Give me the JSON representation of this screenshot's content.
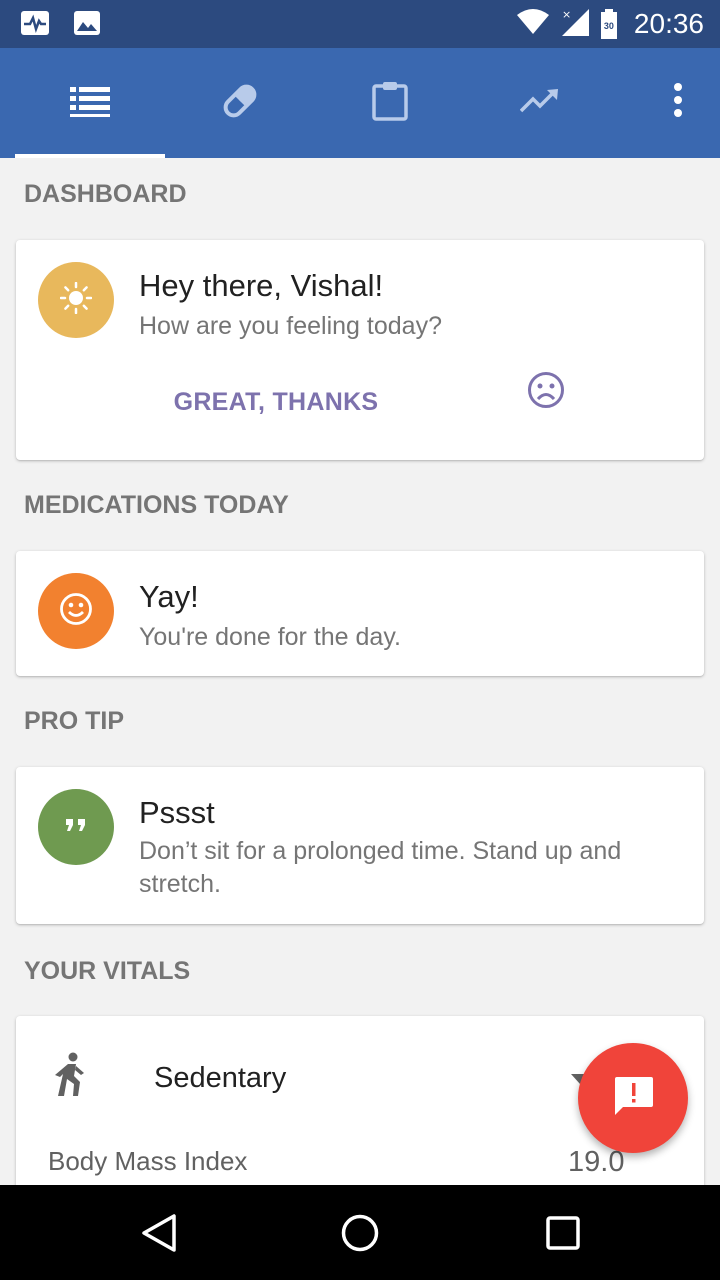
{
  "status_bar": {
    "time": "20:36",
    "left_icons": [
      "pulse-notification-icon",
      "image-notification-icon"
    ],
    "right_icons": [
      "wifi-icon",
      "signal-icon",
      "battery-icon"
    ],
    "battery_level": "30"
  },
  "app_bar": {
    "tabs": [
      {
        "name": "dashboard",
        "icon": "list-icon",
        "active": true
      },
      {
        "name": "medications",
        "icon": "pill-icon",
        "active": false
      },
      {
        "name": "records",
        "icon": "clipboard-icon",
        "active": false
      },
      {
        "name": "trends",
        "icon": "trending-icon",
        "active": false
      }
    ],
    "overflow_icon": "more-vert-icon"
  },
  "dashboard": {
    "title": "DASHBOARD",
    "greeting": "Hey there, Vishal!",
    "question": "How are you feeling today?",
    "great_button": "GREAT, THANKS",
    "sad_icon": "sad-face-icon",
    "avatar_icon": "sun-icon",
    "avatar_color": "#e8b85c"
  },
  "medications": {
    "title": "MEDICATIONS TODAY",
    "heading": "Yay!",
    "message": "You're done for the day.",
    "avatar_icon": "smile-icon",
    "avatar_color": "#f2812f"
  },
  "pro_tip": {
    "title": "PRO TIP",
    "heading": "Pssst",
    "message": "Don’t sit for a prolonged time. Stand up and stretch.",
    "avatar_icon": "quote-icon",
    "avatar_color": "#6f9a50"
  },
  "vitals": {
    "title": "YOUR VITALS",
    "activity_icon": "walking-icon",
    "activity_label": "Sedentary",
    "bmi_label": "Body Mass Index",
    "bmi_value": "19.0"
  },
  "fab": {
    "icon": "feedback-icon",
    "color": "#f0443a"
  },
  "nav_bar": {
    "buttons": [
      "back-icon",
      "home-icon",
      "recents-icon"
    ]
  }
}
